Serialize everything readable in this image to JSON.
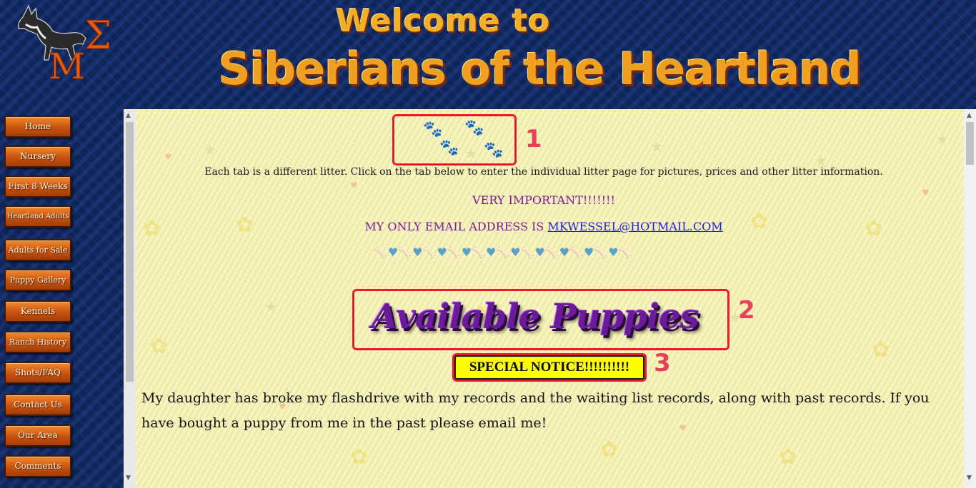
{
  "header": {
    "title_line1": "Welcome to",
    "title_line2": "Siberians of the Heartland"
  },
  "nav": {
    "items": [
      {
        "label": "Home"
      },
      {
        "label": "Nursery"
      },
      {
        "label": "First 8 Weeks"
      },
      {
        "label": "Heartland Adults"
      },
      {
        "label": "Adults for Sale"
      },
      {
        "label": "Puppy Gallery"
      },
      {
        "label": "Kennels"
      },
      {
        "label": "Ranch History"
      },
      {
        "label": "Shots/FAQ"
      },
      {
        "label": "Contact Us"
      },
      {
        "label": "Our Area"
      },
      {
        "label": "Comments"
      }
    ]
  },
  "main": {
    "tab_info": "Each tab is a different litter.  Click on the tab below to enter the individual litter page for pictures, prices and other litter information.",
    "important": "VERY IMPORTANT!!!!!!!",
    "email_prefix": "MY ONLY EMAIL ADDRESS IS ",
    "email_link": "MKWESSEL@HOTMAIL.COM",
    "available_title": "Available Puppies",
    "special_notice": "SPECIAL NOTICE!!!!!!!!!!",
    "body_text": "My daughter has broke my flashdrive with my records and the waiting list records, along with past records.  If you have bought a puppy from me in the past please email me!"
  },
  "markers": {
    "m1": "1",
    "m2": "2",
    "m3": "3"
  },
  "icons": {
    "logo": "husky-logo-icon",
    "paw": "paw-print-icon",
    "bone": "bone-icon",
    "heart": "heart-icon"
  },
  "colors": {
    "annotation_red": "#e81c2c",
    "marker_pink": "#e8405a",
    "nav_orange": "#c8520e",
    "content_bg": "#f8f3b8",
    "purple_text": "#7a1a9a",
    "link_blue": "#1a1ae8",
    "notice_yellow": "#ffff00"
  }
}
